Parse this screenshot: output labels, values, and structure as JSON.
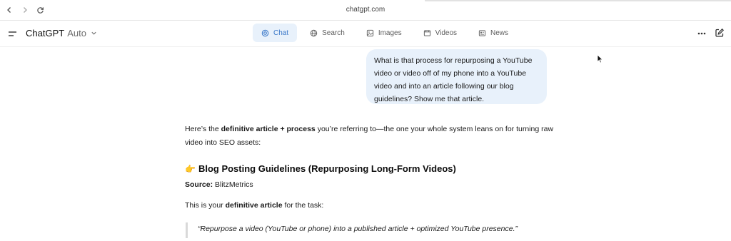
{
  "browser": {
    "url": "chatgpt.com",
    "back_icon": "chevron-left-icon",
    "forward_icon": "chevron-right-icon",
    "reload_icon": "reload-icon"
  },
  "header": {
    "title": "ChatGPT",
    "model": "Auto",
    "tabs": [
      {
        "label": "Chat",
        "icon": "chat-icon",
        "active": true
      },
      {
        "label": "Search",
        "icon": "globe-icon",
        "active": false
      },
      {
        "label": "Images",
        "icon": "image-icon",
        "active": false
      },
      {
        "label": "Videos",
        "icon": "video-icon",
        "active": false
      },
      {
        "label": "News",
        "icon": "news-icon",
        "active": false
      }
    ]
  },
  "conversation": {
    "user_message": "What is that process for repurposing a YouTube video or video off of my phone into a YouTube video and into an article following our blog guidelines? Show me that article.",
    "answer_intro": {
      "pre": "Here’s the ",
      "bold": "definitive article + process",
      "post": " you’re referring to—the one your whole system leans on for turning raw video into SEO assets:"
    },
    "heading_emoji": "👉",
    "heading": "Blog Posting Guidelines (Repurposing Long-Form Videos)",
    "source_label": "Source:",
    "source_value": "BlitzMetrics",
    "para2": {
      "pre": "This is your ",
      "bold": "definitive article",
      "post": " for the task:"
    },
    "quote": "“Repurpose a video (YouTube or phone) into a published article + optimized YouTube presence.”"
  },
  "colors": {
    "accent": "#3a78c9",
    "bubble": "#e8f1fb"
  }
}
